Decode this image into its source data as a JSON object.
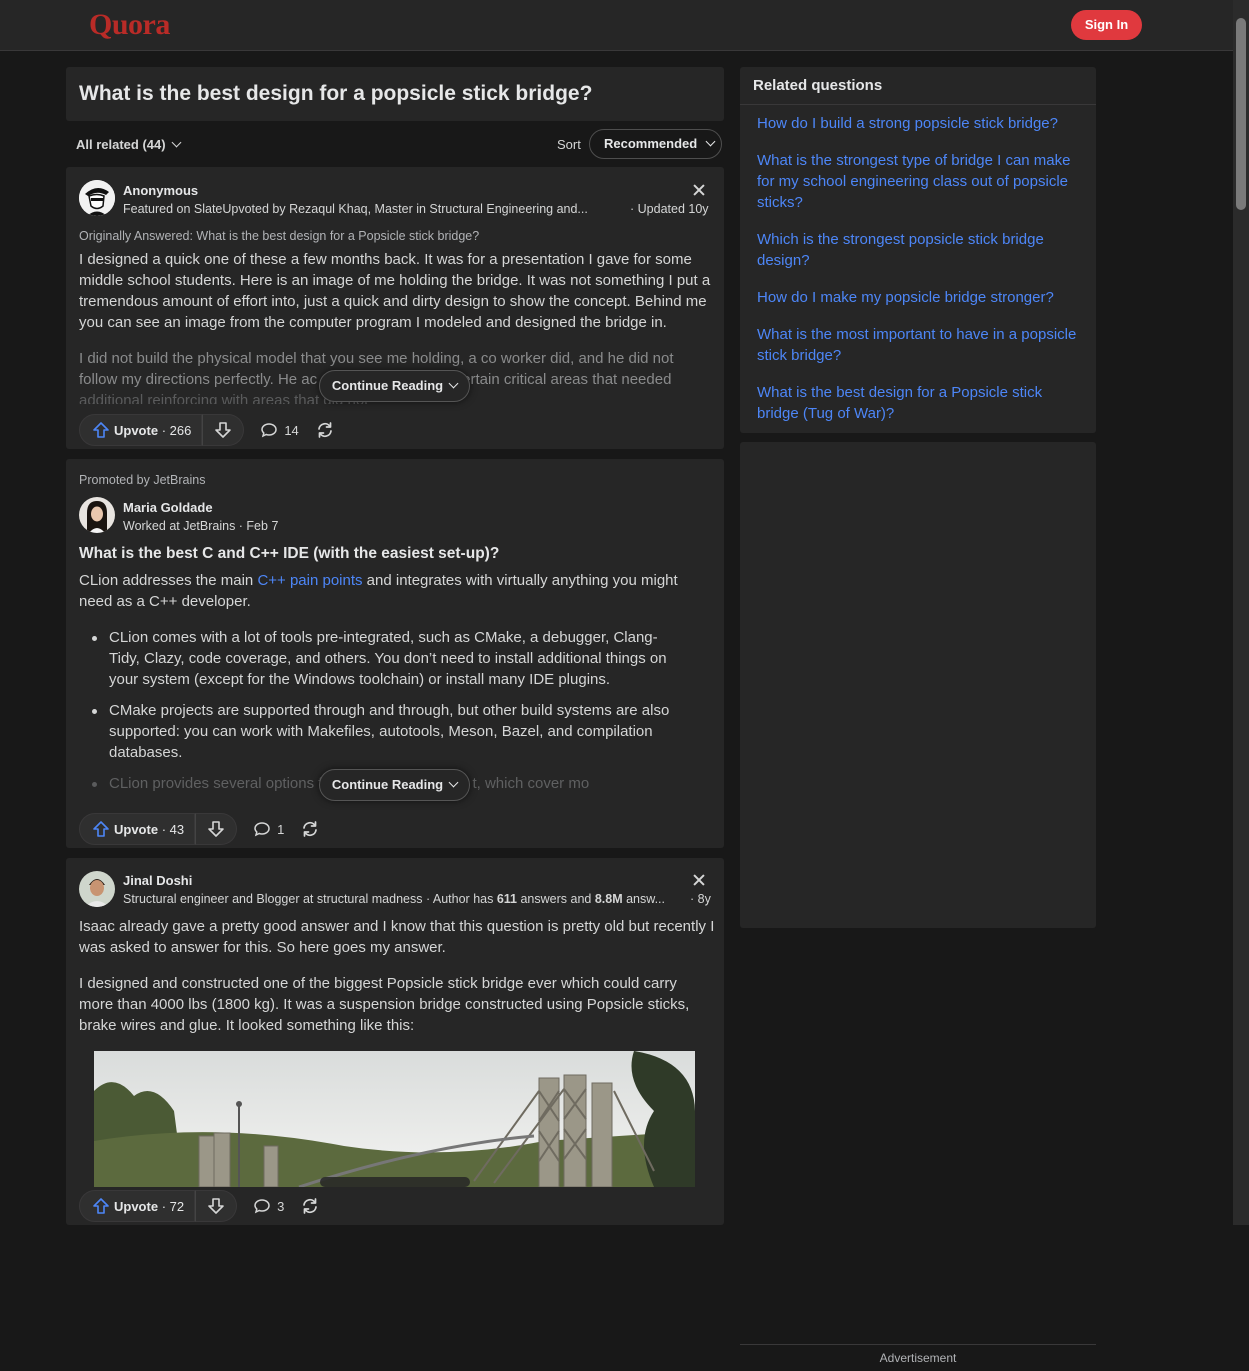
{
  "header": {
    "logo": "Quora",
    "signin_label": "Sign In"
  },
  "question": {
    "title": "What is the best design for a popsicle stick bridge?"
  },
  "filters": {
    "all_related": "All related (44)",
    "sort_label": "Sort",
    "sort_value": "Recommended"
  },
  "answer1": {
    "author": "Anonymous",
    "credential": "Featured on SlateUpvoted by Rezaqul Khaq, Master in Structural Engineering and...",
    "meta": "· Updated 10y",
    "originally_answered": "Originally Answered: What is the best design for a Popsicle stick bridge?",
    "para1": "I designed a quick one of these a few months back. It was for a presentation I gave for some middle school students. Here is an image of me holding the bridge. It was not something I put a tremendous amount of effort into, just a quick and dirty design to show the concept. Behind me you can see an image from the computer program I modeled and designed the bridge in.",
    "para2_a": "I did not build the physical model that you see me holding, a co worker did, and he did not",
    "para2_b1": "follow my directions perfectly. He ac",
    "para2_b2": "ertain critical areas that needed",
    "para2_c": "additional reinforcing with areas that did not",
    "continue_label": "Continue Reading",
    "upvote_label": "Upvote",
    "upvote_count": "· 266",
    "comment_count": "14"
  },
  "promo": {
    "promoted_by": "Promoted by JetBrains",
    "author": "Maria Goldade",
    "credential": "Worked at JetBrains · Feb 7",
    "title": "What is the best C and C++ IDE (with the easiest set-up)?",
    "intro_a": "CLion addresses the main ",
    "intro_link": "C++ pain points",
    "intro_b": " and integrates with virtually anything you might need as a C++ developer.",
    "bullets": [
      "CLion comes with a lot of tools pre-integrated, such as CMake, a debugger, Clang-Tidy, Clazy, code coverage, and others. You don’t need to install additional things on your system (except for the Windows toolchain) or install many IDE plugins.",
      "CMake projects are supported through and through, but other build systems are also supported: you can work with Makefiles, autotools, Meson, Bazel, and compilation databases."
    ],
    "bullet3_a": "CLion provides several options f",
    "bullet3_b": "t, which cover mo",
    "continue_label": "Continue Reading",
    "upvote_label": "Upvote",
    "upvote_count": "· 43",
    "comment_count": "1"
  },
  "answer3": {
    "author": "Jinal Doshi",
    "cred_a": "Structural engineer and Blogger at structural madness · Author has ",
    "cred_b": "611",
    "cred_c": " answers and ",
    "cred_d": "8.8M",
    "cred_e": " answ...",
    "meta": "· 8y",
    "para1": "Isaac already gave a pretty good answer and I know that this question is pretty old but recently I was asked to answer for this. So here goes my answer.",
    "para2": "I designed and constructed one of the biggest Popsicle stick bridge ever which could carry more than 4000 lbs (1800 kg). It was a suspension bridge constructed using Popsicle sticks, brake wires and glue. It looked something like this:",
    "upvote_label": "Upvote",
    "upvote_count": "· 72",
    "comment_count": "3"
  },
  "related": {
    "title": "Related questions",
    "items": [
      "How do I build a strong popsicle stick bridge?",
      "What is the strongest type of bridge I can make for my school engineering class out of popsicle sticks?",
      "Which is the strongest popsicle stick bridge design?",
      "How do I make my popsicle bridge stronger?",
      "What is the most important to have in a popsicle stick bridge?",
      "What is the best design for a Popsicle stick bridge (Tug of War)?"
    ]
  },
  "ad": {
    "label": "Advertisement"
  },
  "colors": {
    "brand": "#b92b27",
    "signin": "#e0393e",
    "link": "#4d86f7",
    "bg": "#181818",
    "card": "#262626"
  }
}
